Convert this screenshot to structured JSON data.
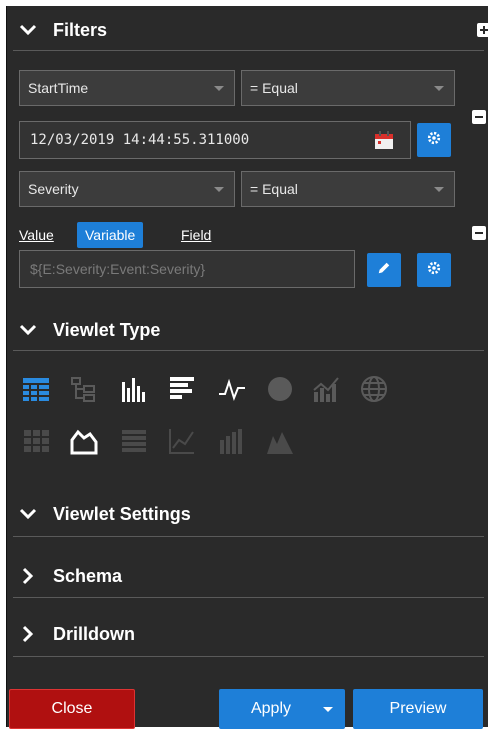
{
  "sections": {
    "filters": "Filters",
    "viewlet_type": "Viewlet Type",
    "viewlet_settings": "Viewlet Settings",
    "schema": "Schema",
    "drilldown": "Drilldown"
  },
  "filter1": {
    "field": "StartTime",
    "operator": "= Equal",
    "value": "12/03/2019 14:44:55.311000"
  },
  "filter2": {
    "field": "Severity",
    "operator": "= Equal",
    "tabs": [
      "Value",
      "Variable",
      "Field"
    ],
    "active_tab": "Variable",
    "variable_value": "${E:Severity:Event:Severity}"
  },
  "viewlet_type_icons": [
    "grid-table-icon",
    "tree-table-icon",
    "bar-chart-icon",
    "horizontal-bar-chart-icon",
    "line-chart-icon",
    "pie-chart-icon",
    "combo-chart-icon",
    "globe-map-icon",
    "heatmap-icon",
    "area-chart-icon",
    "list-icon",
    "scatter-icon",
    "stacked-bar-icon",
    "mountain-chart-icon"
  ],
  "footer": {
    "close": "Close",
    "apply": "Apply",
    "preview": "Preview"
  },
  "colors": {
    "panel_bg": "#2a2a2a",
    "accent_blue": "#1e7fd8",
    "close_red": "#b01010"
  }
}
